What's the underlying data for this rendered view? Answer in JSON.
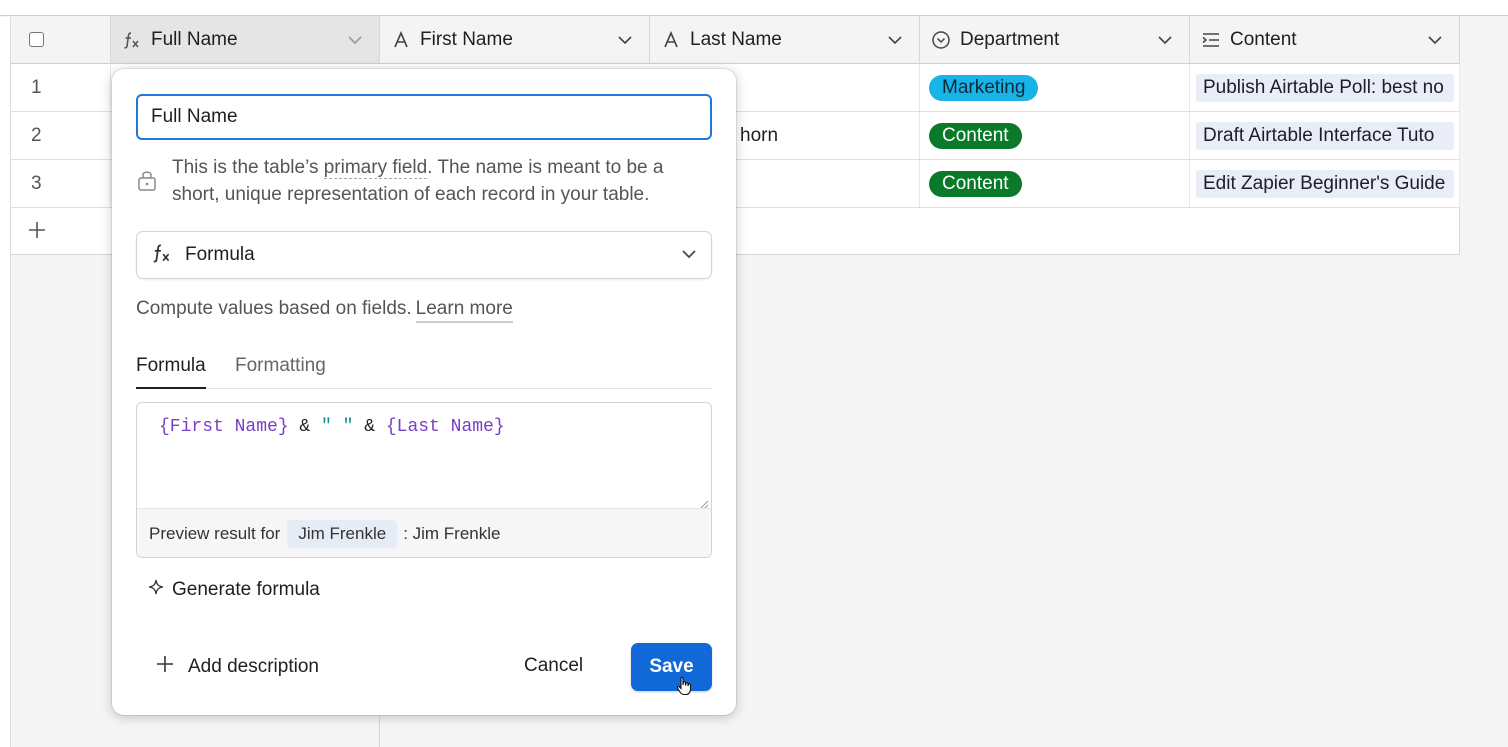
{
  "columns": [
    {
      "label": "Full Name",
      "icon": "formula-icon"
    },
    {
      "label": "First Name",
      "icon": "text-icon"
    },
    {
      "label": "Last Name",
      "icon": "text-icon"
    },
    {
      "label": "Department",
      "icon": "single-select-icon"
    },
    {
      "label": "Content",
      "icon": "long-text-icon"
    }
  ],
  "rows": [
    {
      "num": "1",
      "last_name_partial": "",
      "department": "Marketing",
      "department_color": "#18b4e8",
      "department_text_color": "#0b2a3a",
      "content": "Publish Airtable Poll: best no"
    },
    {
      "num": "2",
      "last_name_partial": "horn",
      "department": "Content",
      "department_color": "#0a7a2a",
      "department_text_color": "#ffffff",
      "content": "Draft Airtable Interface Tuto"
    },
    {
      "num": "3",
      "last_name_partial": "",
      "department": "Content",
      "department_color": "#0a7a2a",
      "department_text_color": "#ffffff",
      "content": "Edit Zapier Beginner's Guide"
    }
  ],
  "popup": {
    "name_value": "Full Name",
    "note_pre": "This is the table’s ",
    "note_link": "primary field",
    "note_line1_post": ". The name is meant to be a",
    "note_line2": "short, unique representation of each record in your table.",
    "type_label": "Formula",
    "description": "Compute values based on fields.",
    "learn_more": "Learn more",
    "tab_formula": "Formula",
    "tab_formatting": "Formatting",
    "formula": {
      "field1": "{First Name}",
      "op1": " & ",
      "str": "\" \"",
      "op2": " & ",
      "field2": "{Last Name}"
    },
    "preview_prefix": "Preview result for",
    "preview_record": "Jim Frenkle",
    "preview_result": ": Jim Frenkle",
    "generate_label": "Generate formula",
    "add_description": "Add description",
    "cancel": "Cancel",
    "save": "Save"
  },
  "colors": {
    "accent": "#1169d8",
    "focus": "#1e78d8",
    "field_token": "#7a3ec4",
    "string_token": "#168a86"
  }
}
